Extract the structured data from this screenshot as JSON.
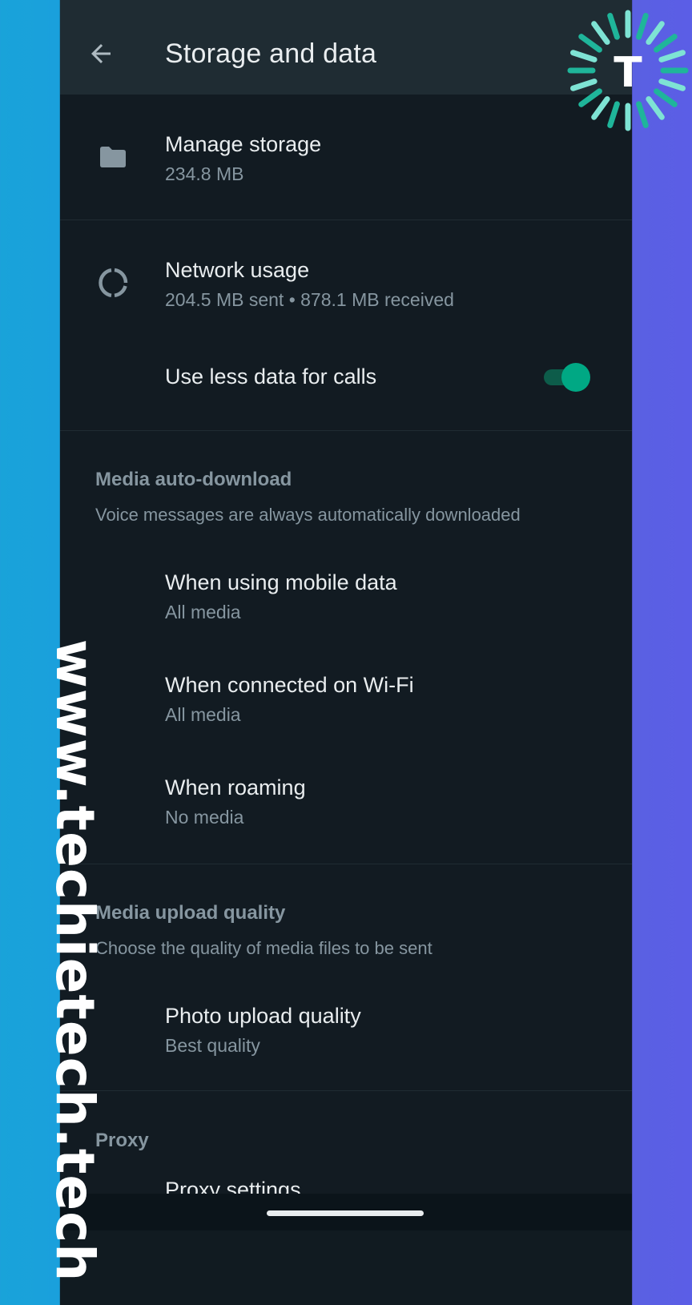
{
  "header": {
    "title": "Storage and data"
  },
  "items": {
    "manage_storage": {
      "label": "Manage storage",
      "value": "234.8 MB"
    },
    "network_usage": {
      "label": "Network usage",
      "value": "204.5 MB sent • 878.1 MB received"
    },
    "less_data_calls": {
      "label": "Use less data for calls",
      "enabled": true
    }
  },
  "media_auto_download": {
    "title": "Media auto-download",
    "subtitle": "Voice messages are always automatically downloaded",
    "mobile": {
      "label": "When using mobile data",
      "value": "All media"
    },
    "wifi": {
      "label": "When connected on Wi-Fi",
      "value": "All media"
    },
    "roaming": {
      "label": "When roaming",
      "value": "No media"
    }
  },
  "media_upload_quality": {
    "title": "Media upload quality",
    "subtitle": "Choose the quality of media files to be sent",
    "photo": {
      "label": "Photo upload quality",
      "value": "Best quality"
    }
  },
  "proxy": {
    "title": "Proxy",
    "settings_label": "Proxy settings"
  },
  "watermark": {
    "text": "www.techietech.tech",
    "logo_letter": "T"
  },
  "colors": {
    "accent": "#00a884",
    "background": "#121b22",
    "appbar": "#1f2c33",
    "primary_text": "#e9edef",
    "secondary_text": "#8696a0",
    "left_border": "#19a3d9",
    "right_border": "#5a60e2"
  }
}
